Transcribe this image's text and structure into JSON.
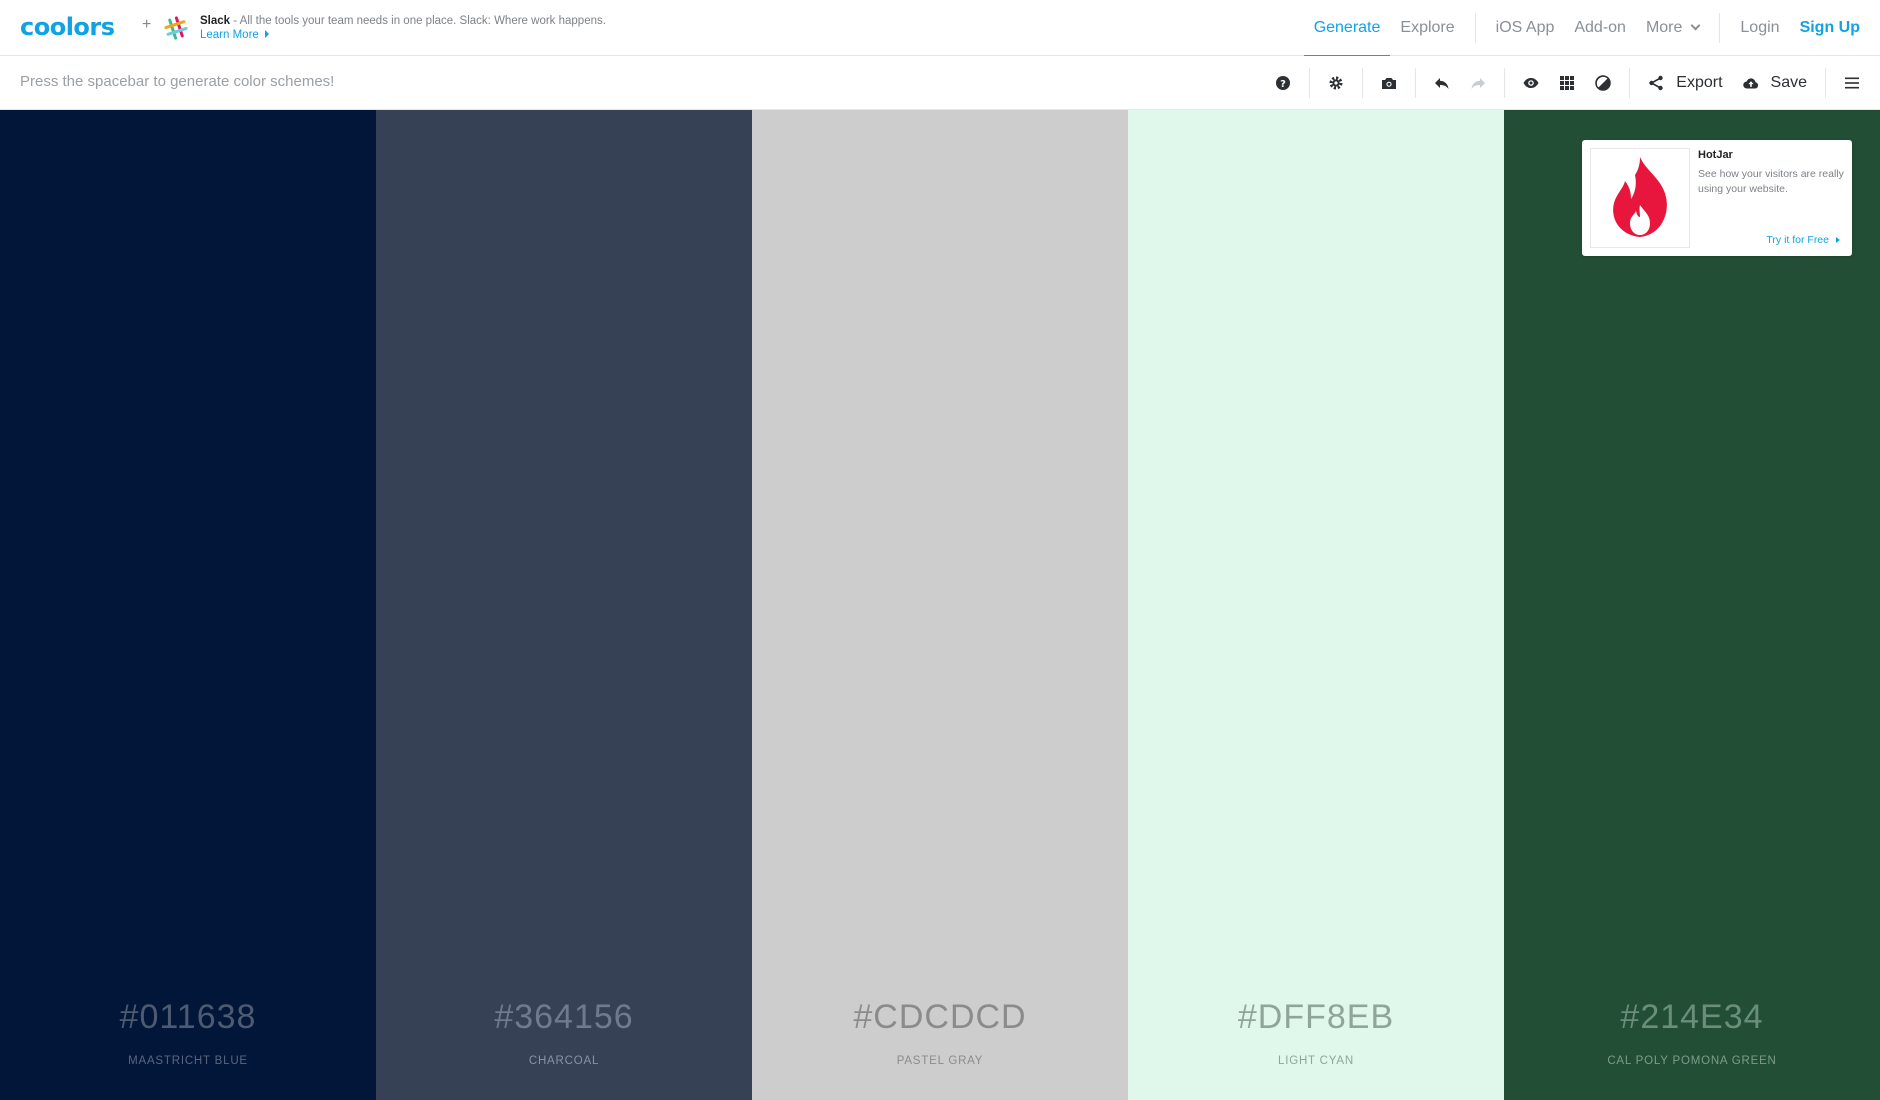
{
  "brand": {
    "logo_text": "coolors"
  },
  "sponsor": {
    "plus": "+",
    "name": "Slack",
    "text": " - All the tools your team needs in one place. Slack: Where work happens. ",
    "link": "Learn More"
  },
  "nav": {
    "generate": "Generate",
    "explore": "Explore",
    "ios_app": "iOS App",
    "add_on": "Add-on",
    "more": "More",
    "login": "Login",
    "signup": "Sign Up"
  },
  "toolbar": {
    "hint": "Press the spacebar to generate color schemes!",
    "export": "Export",
    "save": "Save"
  },
  "palette": [
    {
      "hex": "#011638",
      "name": "Maastricht Blue",
      "bg": "#011638",
      "fg": "#4d5a72",
      "nameColor": "#5a6680"
    },
    {
      "hex": "#364156",
      "name": "Charcoal",
      "bg": "#364156",
      "fg": "#6f7a8e",
      "nameColor": "#8a93a3"
    },
    {
      "hex": "#CDCDCD",
      "name": "Pastel Gray",
      "bg": "#CDCDCD",
      "fg": "#8b8b8b",
      "nameColor": "#8b8b8b"
    },
    {
      "hex": "#DFF8EB",
      "name": "Light Cyan",
      "bg": "#DFF8EB",
      "fg": "#8fa59a",
      "nameColor": "#8fa59a"
    },
    {
      "hex": "#214E34",
      "name": "Cal Poly Pomona Green",
      "bg": "#214E34",
      "fg": "#6a8e79",
      "nameColor": "#7c9c89"
    }
  ],
  "ad": {
    "title": "HotJar",
    "description": "See how your visitors are really using your website.",
    "cta": "Try it for Free"
  },
  "colors": {
    "accent": "#0fa3e6",
    "hotjar": "#e8163c"
  }
}
